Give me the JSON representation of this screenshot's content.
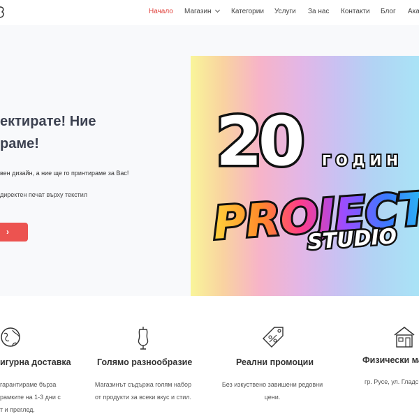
{
  "nav": {
    "items": [
      {
        "label": "Начало",
        "active": true
      },
      {
        "label": "Магазин",
        "dropdown": true
      },
      {
        "label": "Категории"
      },
      {
        "label": "Услуги"
      },
      {
        "label": "За нас"
      },
      {
        "label": "Контакти"
      },
      {
        "label": "Блог"
      },
      {
        "label": "Ака"
      }
    ]
  },
  "hero": {
    "title_line1": "ектирате! Ние",
    "title_line2": "раме!",
    "subtitle": "вен дизайн, а ние ще го принтираме за Вас!",
    "bullet": "директен печат върху текстил",
    "button_label": "›"
  },
  "banner": {
    "number": "20",
    "years": "Г О Д И Н",
    "brand": "PROJECT",
    "brand_sub": "STUDIO"
  },
  "features": [
    {
      "icon": "globe-icon",
      "title": "игурна доставка",
      "lines": [
        "гарантираме бърза",
        "рамките на 1-3 дни с",
        "т и преглед."
      ]
    },
    {
      "icon": "mannequin-icon",
      "title": "Голямо разнообразие",
      "lines": [
        "Магазинът съдържа голям набор",
        "от продукти за всеки вкус и стил."
      ]
    },
    {
      "icon": "price-tag-icon",
      "title": "Реални промоции",
      "lines": [
        "Без изкуствено завишени редовни",
        "цени."
      ]
    },
    {
      "icon": "store-icon",
      "title": "Физически ма",
      "lines": [
        "гр. Русе, ул. Гладс"
      ]
    }
  ],
  "colors": {
    "accent": "#e0413b",
    "button": "#ec5350",
    "heading": "#3c4150"
  }
}
